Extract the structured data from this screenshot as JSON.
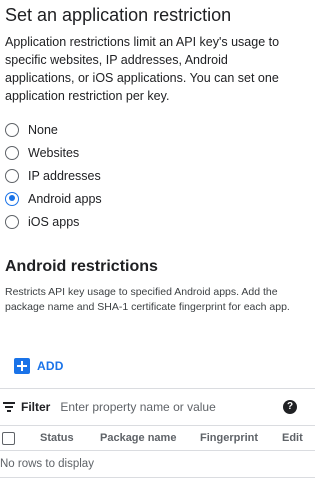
{
  "restriction": {
    "title": "Set an application restriction",
    "description": "Application restrictions limit an API key's usage to specific websites, IP addresses, Android applications, or iOS applications. You can set one application restriction per key.",
    "options": [
      {
        "label": "None",
        "selected": false
      },
      {
        "label": "Websites",
        "selected": false
      },
      {
        "label": "IP addresses",
        "selected": false
      },
      {
        "label": "Android apps",
        "selected": true
      },
      {
        "label": "iOS apps",
        "selected": false
      }
    ]
  },
  "android": {
    "title": "Android restrictions",
    "description": "Restricts API key usage to specified Android apps. Add the package name and SHA-1 certificate fingerprint for each app.",
    "add_label": "ADD",
    "add_icon": "add-box-icon"
  },
  "table": {
    "filter_label": "Filter",
    "filter_placeholder": "Enter property name or value",
    "help_glyph": "?",
    "columns": [
      "Status",
      "Package name",
      "Fingerprint",
      "Edit"
    ],
    "empty_text": "No rows to display"
  },
  "colors": {
    "accent": "#1a73e8",
    "text": "#202124",
    "divider": "#dadce0"
  }
}
